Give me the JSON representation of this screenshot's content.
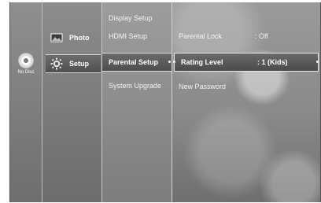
{
  "disc": {
    "label": "No Disc"
  },
  "categories": [
    {
      "label": "Photo",
      "icon": "photo-icon"
    },
    {
      "label": "Setup",
      "icon": "gear-icon",
      "selected": true
    }
  ],
  "submenu": [
    {
      "label": "Display Setup"
    },
    {
      "label": "HDMI Setup"
    },
    {
      "label": "Parental Setup",
      "selected": true
    },
    {
      "label": "System Upgrade"
    }
  ],
  "options": [
    {
      "label": "Parental Lock",
      "value": ": Off"
    },
    {
      "label": "Rating Level",
      "value": ": 1 (Kids)",
      "selected": true
    },
    {
      "label": "New Password",
      "value": ""
    }
  ]
}
